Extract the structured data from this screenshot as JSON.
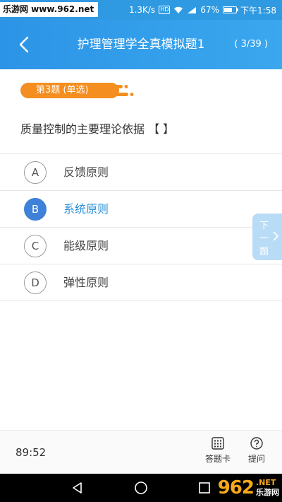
{
  "status_bar": {
    "site": "乐游网 www.962.net",
    "speed": "1.3K/s",
    "hd": "HD",
    "battery": "67%",
    "time": "下午1:58"
  },
  "header": {
    "title": "护理管理学全真模拟题1",
    "progress": "( 3/39 )"
  },
  "question": {
    "type_label": "第3题 (单选)",
    "text": "质量控制的主要理论依据 【 】"
  },
  "options": [
    {
      "letter": "A",
      "text": "反馈原则",
      "selected": false
    },
    {
      "letter": "B",
      "text": "系统原则",
      "selected": true
    },
    {
      "letter": "C",
      "text": "能级原则",
      "selected": false
    },
    {
      "letter": "D",
      "text": "弹性原则",
      "selected": false
    }
  ],
  "next_tab": {
    "c1": "下",
    "c2": "一",
    "c3": "题"
  },
  "bottom": {
    "timer": "89:52",
    "answer_card": "答题卡",
    "ask": "提问"
  },
  "watermark": {
    "big": "962",
    "dot_net": ".NET",
    "cn": "乐游网"
  },
  "colors": {
    "header": "#2f9ae2",
    "pill": "#f58e20",
    "selected": "#3f80d8"
  }
}
